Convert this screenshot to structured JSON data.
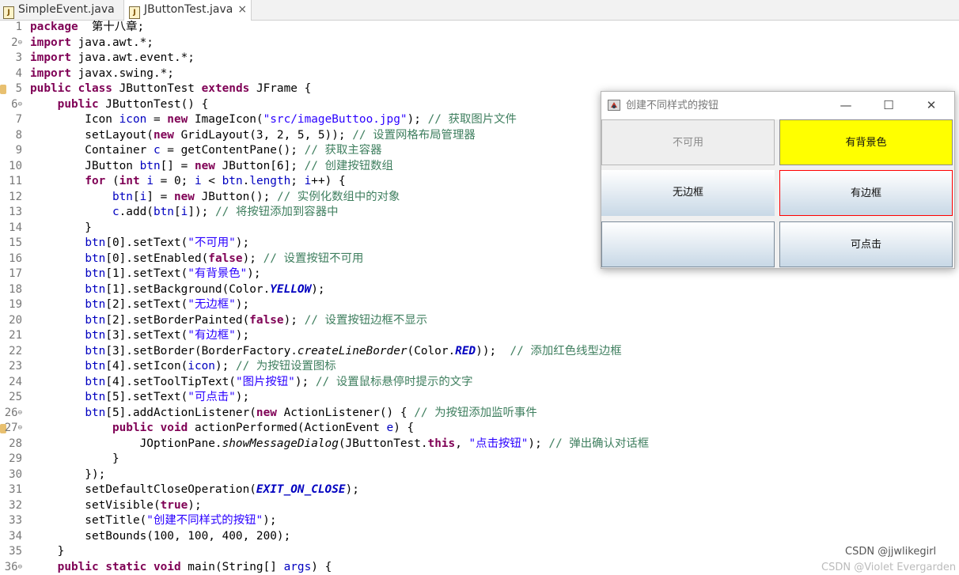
{
  "tabs": [
    {
      "label": "SimpleEvent.java",
      "active": false
    },
    {
      "label": "JButtonTest.java",
      "active": true,
      "close": "×"
    }
  ],
  "code_lines": [
    {
      "n": "1",
      "fold": "",
      "tokens": [
        [
          "kw",
          "package"
        ],
        [
          "",
          "  第十八章;"
        ]
      ]
    },
    {
      "n": "2",
      "fold": "⊖",
      "tokens": [
        [
          "kw",
          "import"
        ],
        [
          "",
          " java.awt.*;"
        ]
      ]
    },
    {
      "n": "3",
      "fold": "",
      "tokens": [
        [
          "kw",
          "import"
        ],
        [
          "",
          " java.awt.event.*;"
        ]
      ]
    },
    {
      "n": "4",
      "fold": "",
      "tokens": [
        [
          "kw",
          "import"
        ],
        [
          "",
          " javax.swing.*;"
        ]
      ]
    },
    {
      "n": "5",
      "fold": "",
      "marker": true,
      "tokens": [
        [
          "kw",
          "public"
        ],
        [
          "",
          " "
        ],
        [
          "kw",
          "class"
        ],
        [
          "",
          " JButtonTest "
        ],
        [
          "kw",
          "extends"
        ],
        [
          "",
          " JFrame {"
        ]
      ]
    },
    {
      "n": "6",
      "fold": "⊖",
      "tokens": [
        [
          "",
          "    "
        ],
        [
          "kw",
          "public"
        ],
        [
          "",
          " JButtonTest() {"
        ]
      ]
    },
    {
      "n": "7",
      "fold": "",
      "tokens": [
        [
          "",
          "        Icon "
        ],
        [
          "fld",
          "icon"
        ],
        [
          "",
          " = "
        ],
        [
          "kw",
          "new"
        ],
        [
          "",
          " ImageIcon("
        ],
        [
          "str",
          "\"src/imageButtoo.jpg\""
        ],
        [
          "",
          "); "
        ],
        [
          "cm",
          "// 获取图片文件"
        ]
      ]
    },
    {
      "n": "8",
      "fold": "",
      "tokens": [
        [
          "",
          "        setLayout("
        ],
        [
          "kw",
          "new"
        ],
        [
          "",
          " GridLayout(3, 2, 5, 5)); "
        ],
        [
          "cm",
          "// 设置网格布局管理器"
        ]
      ]
    },
    {
      "n": "9",
      "fold": "",
      "tokens": [
        [
          "",
          "        Container "
        ],
        [
          "fld",
          "c"
        ],
        [
          "",
          " = getContentPane(); "
        ],
        [
          "cm",
          "// 获取主容器"
        ]
      ]
    },
    {
      "n": "10",
      "fold": "",
      "tokens": [
        [
          "",
          "        JButton "
        ],
        [
          "fld",
          "btn"
        ],
        [
          "",
          "[] = "
        ],
        [
          "kw",
          "new"
        ],
        [
          "",
          " JButton[6]; "
        ],
        [
          "cm",
          "// 创建按钮数组"
        ]
      ]
    },
    {
      "n": "11",
      "fold": "",
      "tokens": [
        [
          "",
          "        "
        ],
        [
          "kw",
          "for"
        ],
        [
          "",
          " ("
        ],
        [
          "kw",
          "int"
        ],
        [
          "",
          " "
        ],
        [
          "fld",
          "i"
        ],
        [
          "",
          " = 0; "
        ],
        [
          "fld",
          "i"
        ],
        [
          "",
          " < "
        ],
        [
          "fld",
          "btn"
        ],
        [
          "",
          "."
        ],
        [
          "fld",
          "length"
        ],
        [
          "",
          "; "
        ],
        [
          "fld",
          "i"
        ],
        [
          "",
          "++) {"
        ]
      ]
    },
    {
      "n": "12",
      "fold": "",
      "tokens": [
        [
          "",
          "            "
        ],
        [
          "fld",
          "btn"
        ],
        [
          "",
          "["
        ],
        [
          "fld",
          "i"
        ],
        [
          "",
          "] = "
        ],
        [
          "kw",
          "new"
        ],
        [
          "",
          " JButton(); "
        ],
        [
          "cm",
          "// 实例化数组中的对象"
        ]
      ]
    },
    {
      "n": "13",
      "fold": "",
      "tokens": [
        [
          "",
          "            "
        ],
        [
          "fld",
          "c"
        ],
        [
          "",
          ".add("
        ],
        [
          "fld",
          "btn"
        ],
        [
          "",
          "["
        ],
        [
          "fld",
          "i"
        ],
        [
          "",
          "]); "
        ],
        [
          "cm",
          "// 将按钮添加到容器中"
        ]
      ]
    },
    {
      "n": "14",
      "fold": "",
      "tokens": [
        [
          "",
          "        }"
        ]
      ]
    },
    {
      "n": "15",
      "fold": "",
      "tokens": [
        [
          "",
          "        "
        ],
        [
          "fld",
          "btn"
        ],
        [
          "",
          "[0].setText("
        ],
        [
          "str",
          "\"不可用\""
        ],
        [
          "",
          ");"
        ]
      ]
    },
    {
      "n": "16",
      "fold": "",
      "tokens": [
        [
          "",
          "        "
        ],
        [
          "fld",
          "btn"
        ],
        [
          "",
          "[0].setEnabled("
        ],
        [
          "kw",
          "false"
        ],
        [
          "",
          "); "
        ],
        [
          "cm",
          "// 设置按钮不可用"
        ]
      ]
    },
    {
      "n": "17",
      "fold": "",
      "tokens": [
        [
          "",
          "        "
        ],
        [
          "fld",
          "btn"
        ],
        [
          "",
          "[1].setText("
        ],
        [
          "str",
          "\"有背景色\""
        ],
        [
          "",
          ");"
        ]
      ]
    },
    {
      "n": "18",
      "fold": "",
      "tokens": [
        [
          "",
          "        "
        ],
        [
          "fld",
          "btn"
        ],
        [
          "",
          "[1].setBackground(Color."
        ],
        [
          "sfld",
          "YELLOW"
        ],
        [
          "",
          ");"
        ]
      ]
    },
    {
      "n": "19",
      "fold": "",
      "tokens": [
        [
          "",
          "        "
        ],
        [
          "fld",
          "btn"
        ],
        [
          "",
          "[2].setText("
        ],
        [
          "str",
          "\"无边框\""
        ],
        [
          "",
          ");"
        ]
      ]
    },
    {
      "n": "20",
      "fold": "",
      "tokens": [
        [
          "",
          "        "
        ],
        [
          "fld",
          "btn"
        ],
        [
          "",
          "[2].setBorderPainted("
        ],
        [
          "kw",
          "false"
        ],
        [
          "",
          "); "
        ],
        [
          "cm",
          "// 设置按钮边框不显示"
        ]
      ]
    },
    {
      "n": "21",
      "fold": "",
      "tokens": [
        [
          "",
          "        "
        ],
        [
          "fld",
          "btn"
        ],
        [
          "",
          "[3].setText("
        ],
        [
          "str",
          "\"有边框\""
        ],
        [
          "",
          ");"
        ]
      ]
    },
    {
      "n": "22",
      "fold": "",
      "tokens": [
        [
          "",
          "        "
        ],
        [
          "fld",
          "btn"
        ],
        [
          "",
          "[3].setBorder(BorderFactory."
        ],
        [
          "it",
          "createLineBorder"
        ],
        [
          "",
          "(Color."
        ],
        [
          "sfld",
          "RED"
        ],
        [
          "",
          "));  "
        ],
        [
          "cm",
          "// 添加红色线型边框"
        ]
      ]
    },
    {
      "n": "23",
      "fold": "",
      "tokens": [
        [
          "",
          "        "
        ],
        [
          "fld",
          "btn"
        ],
        [
          "",
          "[4].setIcon("
        ],
        [
          "fld",
          "icon"
        ],
        [
          "",
          "); "
        ],
        [
          "cm",
          "// 为按钮设置图标"
        ]
      ]
    },
    {
      "n": "24",
      "fold": "",
      "tokens": [
        [
          "",
          "        "
        ],
        [
          "fld",
          "btn"
        ],
        [
          "",
          "[4].setToolTipText("
        ],
        [
          "str",
          "\"图片按钮\""
        ],
        [
          "",
          "); "
        ],
        [
          "cm",
          "// 设置鼠标悬停时提示的文字"
        ]
      ]
    },
    {
      "n": "25",
      "fold": "",
      "tokens": [
        [
          "",
          "        "
        ],
        [
          "fld",
          "btn"
        ],
        [
          "",
          "[5].setText("
        ],
        [
          "str",
          "\"可点击\""
        ],
        [
          "",
          ");"
        ]
      ]
    },
    {
      "n": "26",
      "fold": "⊖",
      "tokens": [
        [
          "",
          "        "
        ],
        [
          "fld",
          "btn"
        ],
        [
          "",
          "[5].addActionListener("
        ],
        [
          "kw",
          "new"
        ],
        [
          "",
          " ActionListener() { "
        ],
        [
          "cm",
          "// 为按钮添加监听事件"
        ]
      ]
    },
    {
      "n": "27",
      "fold": "⊖",
      "marker": true,
      "tokens": [
        [
          "",
          "            "
        ],
        [
          "kw",
          "public"
        ],
        [
          "",
          " "
        ],
        [
          "kw",
          "void"
        ],
        [
          "",
          " actionPerformed(ActionEvent "
        ],
        [
          "fld",
          "e"
        ],
        [
          "",
          ") {"
        ]
      ]
    },
    {
      "n": "28",
      "fold": "",
      "tokens": [
        [
          "",
          "                JOptionPane."
        ],
        [
          "it",
          "showMessageDialog"
        ],
        [
          "",
          "(JButtonTest."
        ],
        [
          "kw",
          "this"
        ],
        [
          "",
          ", "
        ],
        [
          "str",
          "\"点击按钮\""
        ],
        [
          "",
          "); "
        ],
        [
          "cm",
          "// 弹出确认对话框"
        ]
      ]
    },
    {
      "n": "29",
      "fold": "",
      "tokens": [
        [
          "",
          "            }"
        ]
      ]
    },
    {
      "n": "30",
      "fold": "",
      "tokens": [
        [
          "",
          "        });"
        ]
      ]
    },
    {
      "n": "31",
      "fold": "",
      "tokens": [
        [
          "",
          "        setDefaultCloseOperation("
        ],
        [
          "sfld",
          "EXIT_ON_CLOSE"
        ],
        [
          "",
          ");"
        ]
      ]
    },
    {
      "n": "32",
      "fold": "",
      "tokens": [
        [
          "",
          "        setVisible("
        ],
        [
          "kw",
          "true"
        ],
        [
          "",
          ");"
        ]
      ]
    },
    {
      "n": "33",
      "fold": "",
      "tokens": [
        [
          "",
          "        setTitle("
        ],
        [
          "str",
          "\"创建不同样式的按钮\""
        ],
        [
          "",
          ");"
        ]
      ]
    },
    {
      "n": "34",
      "fold": "",
      "tokens": [
        [
          "",
          "        setBounds(100, 100, 400, 200);"
        ]
      ]
    },
    {
      "n": "35",
      "fold": "",
      "tokens": [
        [
          "",
          "    }"
        ]
      ]
    },
    {
      "n": "36",
      "fold": "⊖",
      "tokens": [
        [
          "",
          "    "
        ],
        [
          "kw",
          "public"
        ],
        [
          "",
          " "
        ],
        [
          "kw",
          "static"
        ],
        [
          "",
          " "
        ],
        [
          "kw",
          "void"
        ],
        [
          "",
          " main(String[] "
        ],
        [
          "fld",
          "args"
        ],
        [
          "",
          ") {"
        ]
      ]
    }
  ],
  "window": {
    "title": "创建不同样式的按钮",
    "minimize": "—",
    "maximize": "☐",
    "close": "✕",
    "buttons": [
      {
        "label": "不可用",
        "style": "disabled"
      },
      {
        "label": "有背景色",
        "style": "yellow"
      },
      {
        "label": "无边框",
        "style": "noborder"
      },
      {
        "label": "有边框",
        "style": "redborder"
      },
      {
        "label": "",
        "style": "icon"
      },
      {
        "label": "可点击",
        "style": "normal"
      }
    ]
  },
  "watermark": "CSDN @jjwlikegirl",
  "watermark2": "CSDN @Violet Evergarden"
}
